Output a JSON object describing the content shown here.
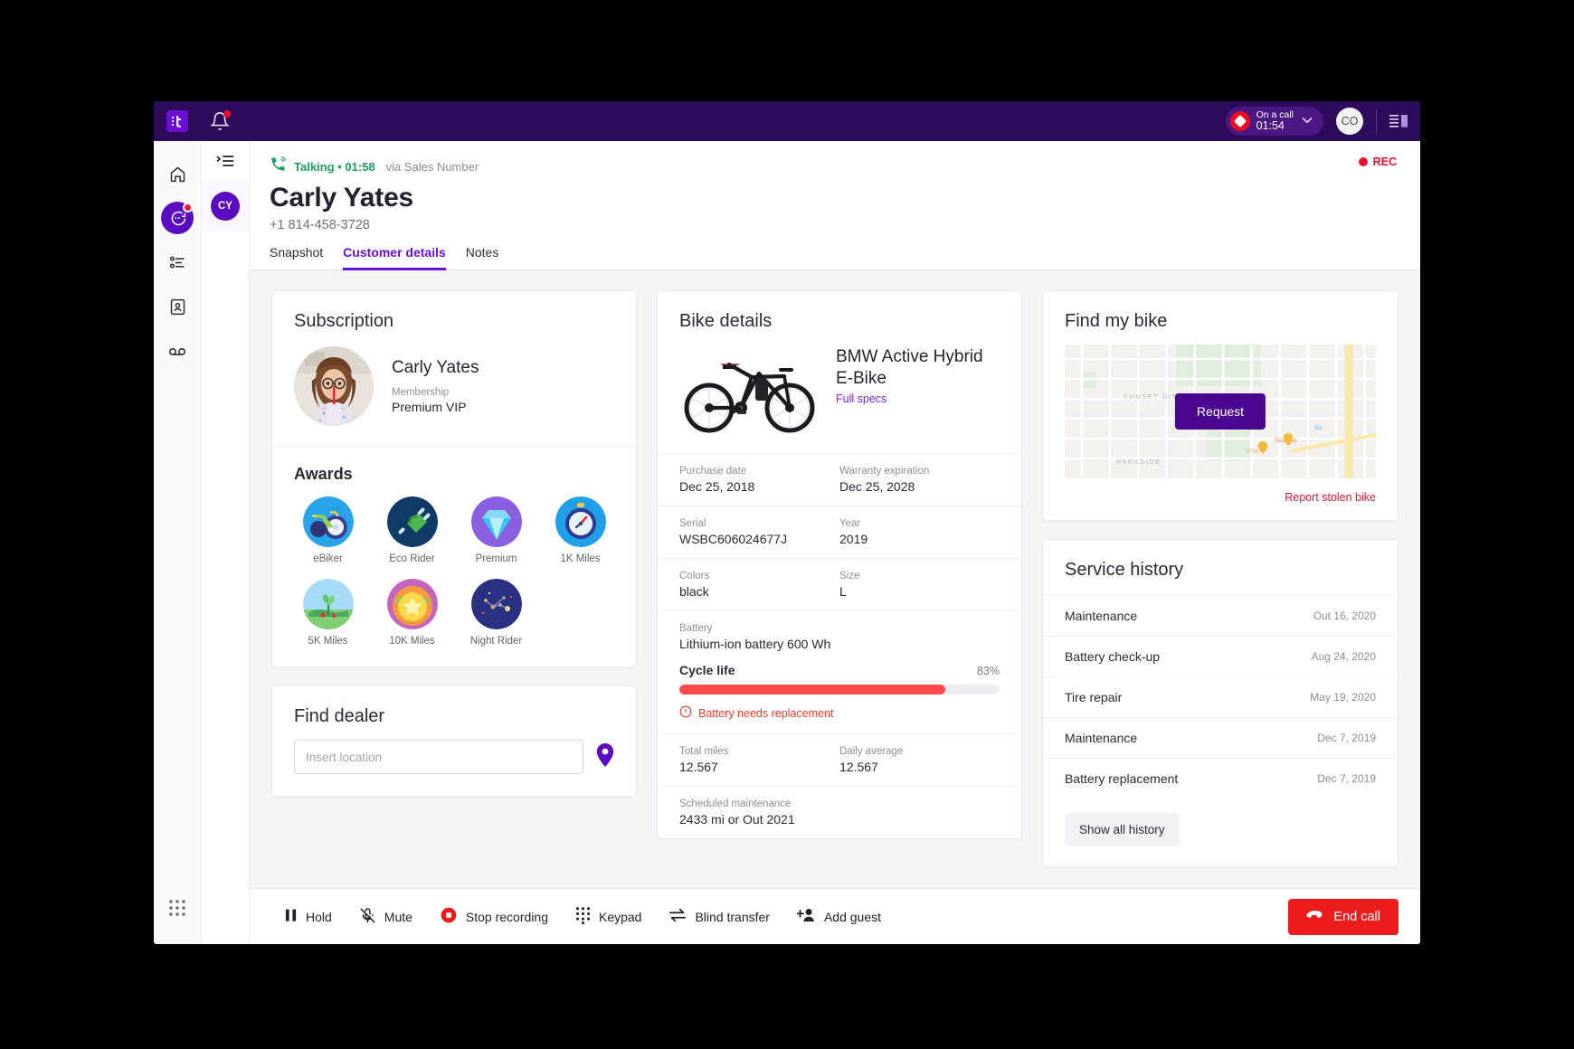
{
  "topbar": {
    "logo": "it",
    "logo_icon": "talkdesk-logo-icon",
    "bell_icon": "notification-bell-icon",
    "call_status_label": "On a call",
    "call_status_timer": "01:54",
    "dropdown_icon": "chevron-down-icon",
    "user_initials": "CO",
    "panel_icon": "panel-layout-icon",
    "accent": "#2d0b5a"
  },
  "rail": {
    "items": [
      {
        "name": "home",
        "icon": "home-icon"
      },
      {
        "name": "conversations",
        "icon": "conversation-bubble-icon",
        "badge": true,
        "active": true
      },
      {
        "name": "activity",
        "icon": "activity-list-icon"
      },
      {
        "name": "contacts",
        "icon": "contact-card-icon"
      },
      {
        "name": "voicemail",
        "icon": "voicemail-icon"
      }
    ],
    "bottom_icon": "apps-grid-icon"
  },
  "contact_rail": {
    "collapse_icon": "collapse-panel-icon",
    "entry_initials": "CY",
    "entry_status_icon": "phone-active-icon"
  },
  "call": {
    "status_icon": "phone-ringing-icon",
    "status": "Talking • 01:58",
    "via": "via Sales Number",
    "customer_name": "Carly Yates",
    "phone": "+1 814-458-3728",
    "recording_label": "REC",
    "recording_icon": "recording-dot-icon"
  },
  "tabs": [
    {
      "label": "Snapshot",
      "active": false
    },
    {
      "label": "Customer details",
      "active": true
    },
    {
      "label": "Notes",
      "active": false
    }
  ],
  "subscription": {
    "title": "Subscription",
    "avatar_icon": "customer-photo",
    "name": "Carly Yates",
    "membership_label": "Membership",
    "membership_value": "Premium VIP"
  },
  "awards": {
    "title": "Awards",
    "items": [
      {
        "label": "eBiker",
        "icon": "ebiker-badge-icon"
      },
      {
        "label": "Eco Rider",
        "icon": "eco-rider-badge-icon"
      },
      {
        "label": "Premium",
        "icon": "premium-diamond-badge-icon"
      },
      {
        "label": "1K Miles",
        "icon": "1k-miles-badge-icon"
      },
      {
        "label": "5K Miles",
        "icon": "5k-miles-badge-icon"
      },
      {
        "label": "10K Miles",
        "icon": "10k-miles-badge-icon"
      },
      {
        "label": "Night Rider",
        "icon": "night-rider-badge-icon"
      }
    ]
  },
  "find_dealer": {
    "title": "Find dealer",
    "placeholder": "Insert location",
    "value": "",
    "pin_icon": "map-pin-icon"
  },
  "bike_details": {
    "title": "Bike details",
    "image_icon": "bicycle-photo",
    "model": "BMW Active Hybrid E-Bike",
    "full_specs_link": "Full specs",
    "fields": [
      [
        {
          "label": "Purchase date",
          "value": "Dec 25, 2018"
        },
        {
          "label": "Warranty expiration",
          "value": "Dec 25, 2028"
        }
      ],
      [
        {
          "label": "Serial",
          "value": "WSBC606024677J"
        },
        {
          "label": "Year",
          "value": "2019"
        }
      ],
      [
        {
          "label": "Colors",
          "value": "black"
        },
        {
          "label": "Size",
          "value": "L"
        }
      ]
    ],
    "battery_label": "Battery",
    "battery_value": "Lithium-ion battery 600 Wh",
    "cycle_label": "Cycle life",
    "cycle_pct_text": "83%",
    "cycle_pct": 83,
    "warning_icon": "alert-circle-icon",
    "warning_text": "Battery needs replacement",
    "mileage": [
      {
        "label": "Total miles",
        "value": "12.567"
      },
      {
        "label": "Daily average",
        "value": "12.567"
      }
    ],
    "maintenance_label": "Scheduled maintenance",
    "maintenance_value": "2433 mi or Out 2021",
    "bar_color": "#fb4a4a"
  },
  "find_my_bike": {
    "title": "Find my bike",
    "map_icon": "map-thumbnail",
    "request_button": "Request",
    "stolen_link": "Report stolen bike",
    "map_labels": [
      "SUNSET DISTRICT",
      "PARKSIDE",
      "Taco Bell",
      "STIX"
    ]
  },
  "service_history": {
    "title": "Service history",
    "rows": [
      {
        "name": "Maintenance",
        "date": "Out 16, 2020"
      },
      {
        "name": "Battery check-up",
        "date": "Aug 24, 2020"
      },
      {
        "name": "Tire repair",
        "date": "May 19, 2020"
      },
      {
        "name": "Maintenance",
        "date": "Dec 7, 2019"
      },
      {
        "name": "Battery replacement",
        "date": "Dec 7, 2019"
      }
    ],
    "show_all_button": "Show all history"
  },
  "toolbar": {
    "items": [
      {
        "label": "Hold",
        "icon": "pause-icon"
      },
      {
        "label": "Mute",
        "icon": "mic-muted-icon"
      },
      {
        "label": "Stop recording",
        "icon": "stop-recording-icon"
      },
      {
        "label": "Keypad",
        "icon": "keypad-dots-icon"
      },
      {
        "label": "Blind transfer",
        "icon": "transfer-arrows-icon"
      },
      {
        "label": "Add guest",
        "icon": "add-person-icon"
      }
    ],
    "end_call_label": "End call",
    "end_call_icon": "phone-hangup-icon"
  }
}
